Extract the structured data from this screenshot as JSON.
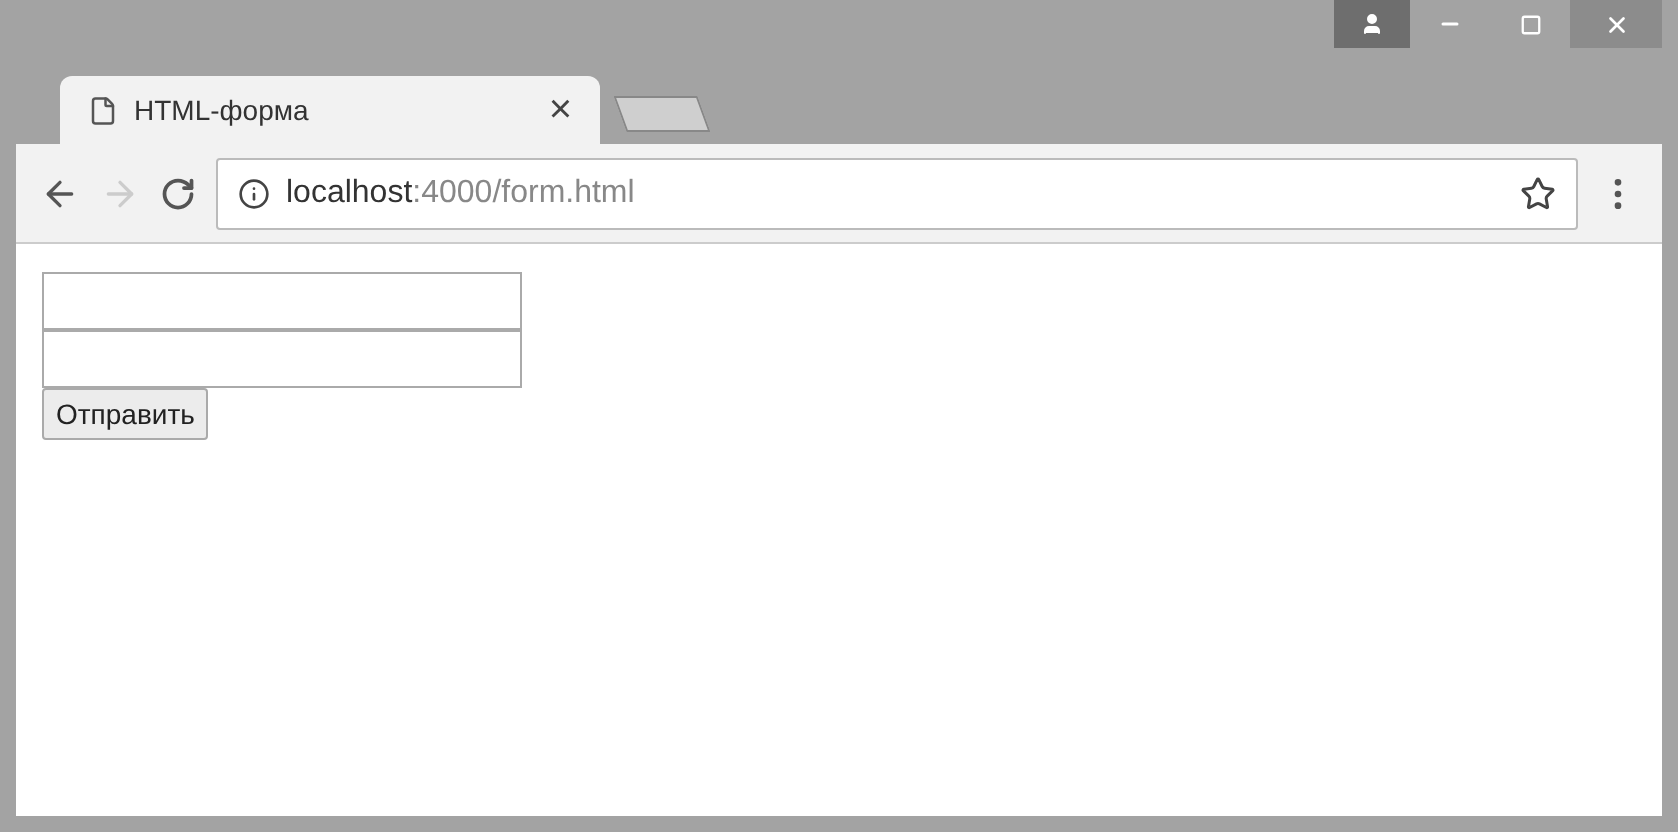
{
  "tab": {
    "title": "HTML-форма",
    "close": "×"
  },
  "address": {
    "host": "localhost",
    "path": ":4000/form.html"
  },
  "form": {
    "fields": [
      {
        "kind": "text"
      },
      {
        "kind": "text"
      }
    ],
    "submit": "Отправить"
  }
}
